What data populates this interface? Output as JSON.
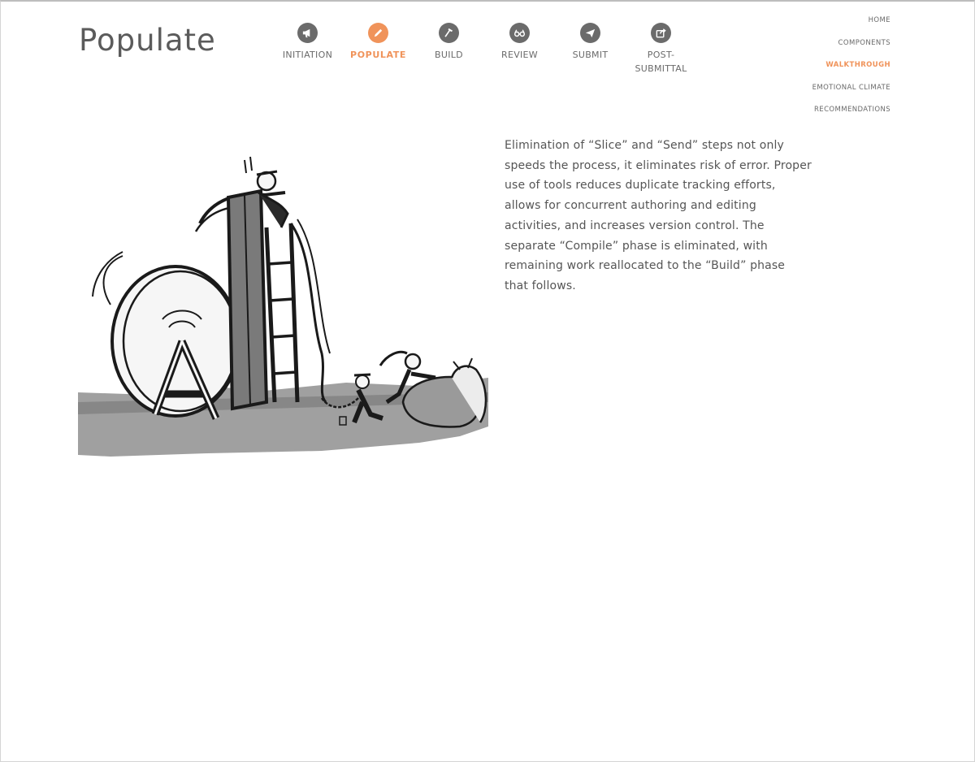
{
  "page": {
    "title": "Populate"
  },
  "phases": [
    {
      "label": "INITIATION",
      "icon": "megaphone-icon",
      "active": false
    },
    {
      "label": "POPULATE",
      "icon": "pencil-icon",
      "active": true
    },
    {
      "label": "BUILD",
      "icon": "hammer-icon",
      "active": false
    },
    {
      "label": "REVIEW",
      "icon": "glasses-icon",
      "active": false
    },
    {
      "label": "SUBMIT",
      "icon": "paper-plane-icon",
      "active": false
    },
    {
      "label": "POST-\nSUBMITTAL",
      "icon": "share-icon",
      "active": false
    }
  ],
  "side_nav": [
    {
      "label": "HOME",
      "active": false
    },
    {
      "label": "COMPONENTS",
      "active": false
    },
    {
      "label": "WALKTHROUGH",
      "active": true
    },
    {
      "label": "EMOTIONAL CLIMATE",
      "active": false
    },
    {
      "label": "RECOMMENDATIONS",
      "active": false
    }
  ],
  "content": {
    "body": "Elimination of “Slice” and “Send” steps not only speeds the process, it eliminates risk of error. Proper use of tools reduces duplicate tracking efforts, allows for concurrent authoring and editing activities, and increases version control. The separate “Compile” phase is eliminated, with remaining work reallocated to the “Build” phase that follows."
  },
  "colors": {
    "accent": "#f0935a",
    "icon_bg": "#6b6b6b",
    "text": "#555555"
  }
}
